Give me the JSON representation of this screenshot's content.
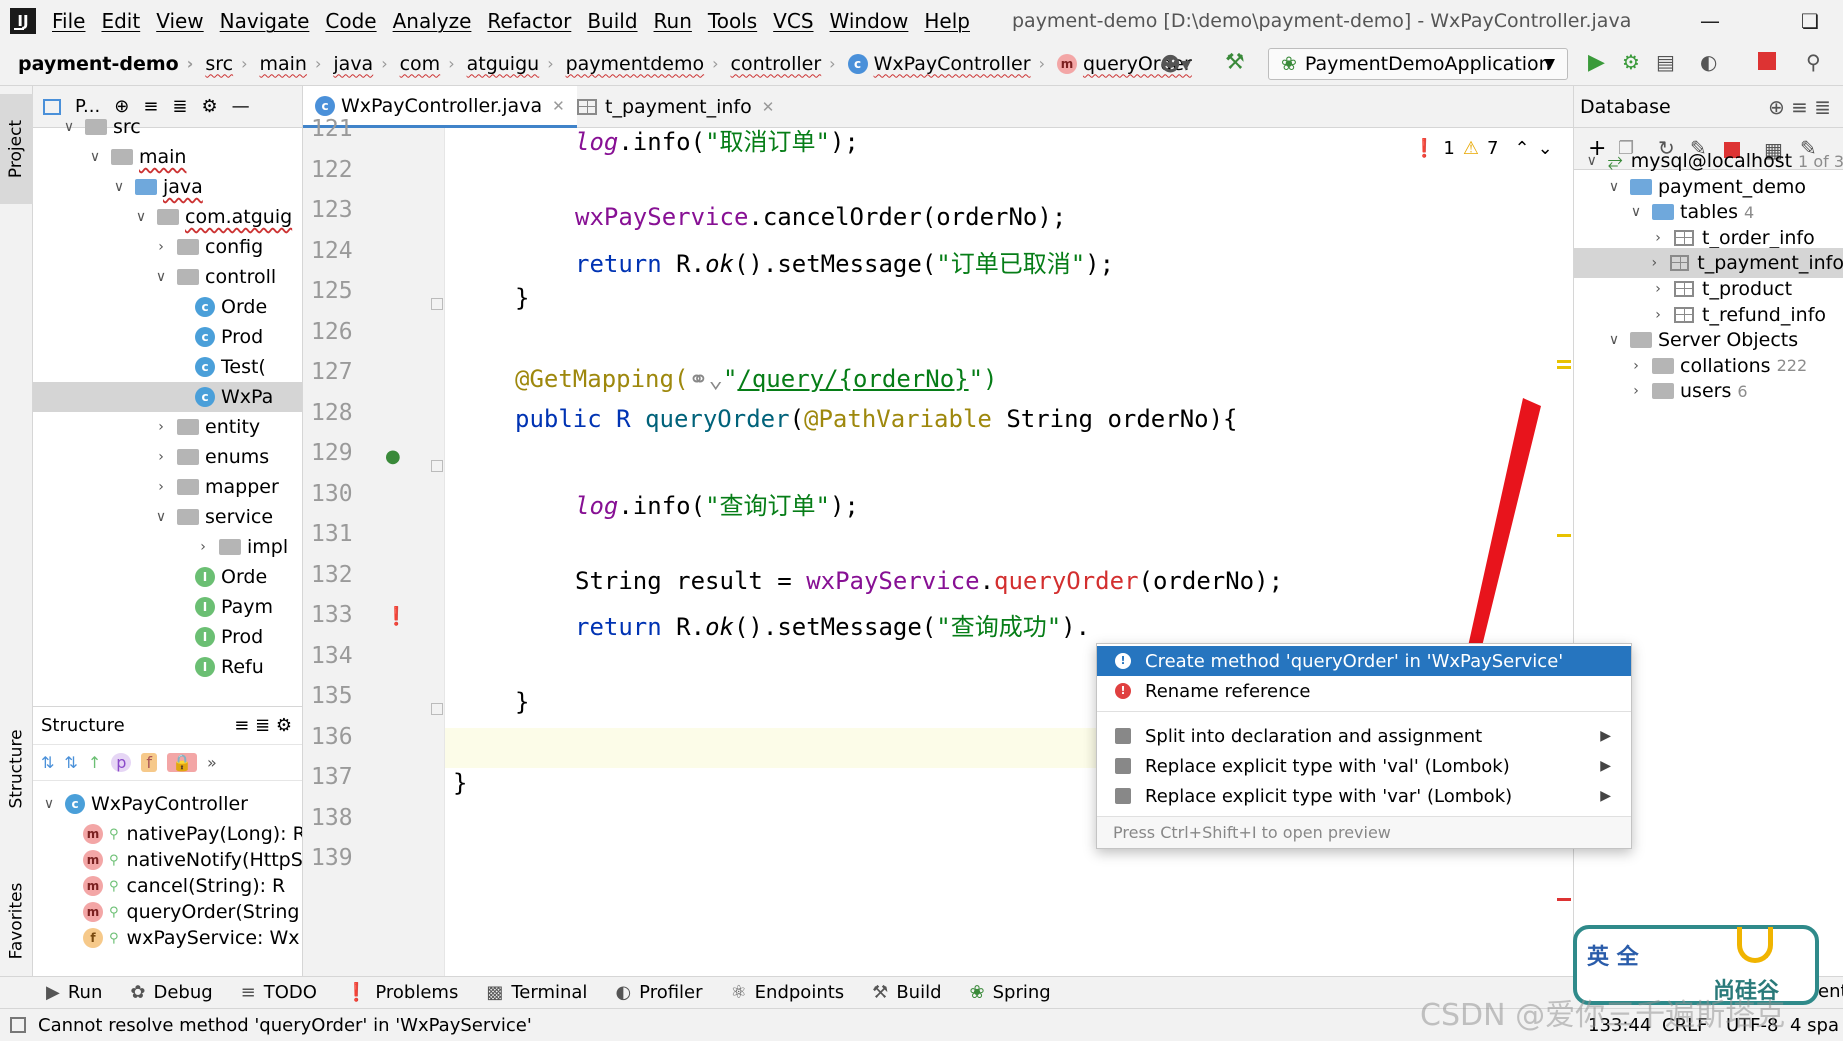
{
  "window": {
    "title": "payment-demo [D:\\demo\\payment-demo] - WxPayController.java",
    "menu": [
      "File",
      "Edit",
      "View",
      "Navigate",
      "Code",
      "Analyze",
      "Refactor",
      "Build",
      "Run",
      "Tools",
      "VCS",
      "Window",
      "Help"
    ]
  },
  "breadcrumb": {
    "items": [
      "payment-demo",
      "src",
      "main",
      "java",
      "com",
      "atguigu",
      "paymentdemo",
      "controller",
      "WxPayController",
      "queryOrder"
    ]
  },
  "run_config": {
    "label": "PaymentDemoApplication"
  },
  "left_stripe": {
    "project": "Project",
    "structure": "Structure",
    "favorites": "Favorites"
  },
  "project_panel": {
    "header": "P...",
    "tree": [
      {
        "label": "src",
        "level": 1,
        "type": "folder"
      },
      {
        "label": "main",
        "level": 2,
        "type": "folder"
      },
      {
        "label": "java",
        "level": 3,
        "type": "folder-blue"
      },
      {
        "label": "com.atguig",
        "level": 4,
        "type": "package"
      },
      {
        "label": "config",
        "level": 5,
        "type": "package"
      },
      {
        "label": "controll",
        "level": 5,
        "type": "package"
      },
      {
        "label": "Orde",
        "level": 6,
        "type": "class"
      },
      {
        "label": "Prod",
        "level": 6,
        "type": "class"
      },
      {
        "label": "Test(",
        "level": 6,
        "type": "class"
      },
      {
        "label": "WxPa",
        "level": 6,
        "type": "class",
        "selected": true
      },
      {
        "label": "entity",
        "level": 5,
        "type": "package"
      },
      {
        "label": "enums",
        "level": 5,
        "type": "package"
      },
      {
        "label": "mapper",
        "level": 5,
        "type": "package"
      },
      {
        "label": "service",
        "level": 5,
        "type": "package"
      },
      {
        "label": "impl",
        "level": 6,
        "type": "package"
      },
      {
        "label": "Orde",
        "level": 6,
        "type": "interface"
      },
      {
        "label": "Paym",
        "level": 6,
        "type": "interface"
      },
      {
        "label": "Prod",
        "level": 6,
        "type": "interface"
      },
      {
        "label": "Refu",
        "level": 6,
        "type": "interface"
      }
    ]
  },
  "structure_panel": {
    "title": "Structure",
    "root": "WxPayController",
    "members": [
      {
        "badge": "m",
        "label": "nativePay(Long): R"
      },
      {
        "badge": "m",
        "label": "nativeNotify(HttpS"
      },
      {
        "badge": "m",
        "label": "cancel(String): R"
      },
      {
        "badge": "m",
        "label": "queryOrder(String"
      },
      {
        "badge": "f",
        "label": "wxPayService: Wx"
      }
    ]
  },
  "editor_tabs": [
    {
      "label": "WxPayController.java",
      "active": true
    },
    {
      "label": "t_payment_info",
      "active": false
    }
  ],
  "inspections": {
    "errors": "1",
    "warnings": "7"
  },
  "line_numbers": [
    "121",
    "122",
    "123",
    "124",
    "125",
    "126",
    "127",
    "128",
    "129",
    "130",
    "131",
    "132",
    "133",
    "134",
    "135",
    "136",
    "137",
    "138",
    "139"
  ],
  "code": {
    "l121": {
      "a": "log",
      "b": ".info(",
      "c": "\"取消订单\"",
      "d": ");"
    },
    "l123": {
      "a": "wxPayService",
      "b": ".cancelOrder(orderNo);"
    },
    "l124": {
      "a": "return ",
      "b": "R.",
      "c": "ok",
      "d": "().setMessage(",
      "e": "\"订单已取消\"",
      "f": ");"
    },
    "l125": "}",
    "l128": {
      "a": "@GetMapping(",
      "b": "\"",
      "c": "/query/{orderNo}",
      "d": "\")"
    },
    "l129": {
      "a": "public ",
      "b": "R ",
      "c": "queryOrder",
      "d": "(",
      "e": "@PathVariable ",
      "f": "String orderNo){"
    },
    "l131": {
      "a": "log",
      "b": ".info(",
      "c": "\"查询订单\"",
      "d": ");"
    },
    "l133": {
      "a": "String result = ",
      "b": "wxPayService",
      "c": ".",
      "d": "queryOrder",
      "e": "(orderNo);"
    },
    "l134": {
      "a": "return ",
      "b": "R.",
      "c": "ok",
      "d": "().setMessage(",
      "e": "\"查询成功\"",
      "f": ")."
    },
    "l136": "}",
    "l138": "}"
  },
  "popup": {
    "items": [
      {
        "label": "Create method 'queryOrder' in 'WxPayService'",
        "selected": true,
        "icon": "bulb-error-icon"
      },
      {
        "label": "Rename reference",
        "icon": "bulb-error-icon"
      },
      {
        "label": "Split into declaration and assignment",
        "icon": "intention-icon",
        "submenu": true
      },
      {
        "label": "Replace explicit type with 'val' (Lombok)",
        "icon": "intention-icon",
        "submenu": true
      },
      {
        "label": "Replace explicit type with 'var' (Lombok)",
        "icon": "intention-icon",
        "submenu": true
      }
    ],
    "footer": "Press Ctrl+Shift+I to open preview"
  },
  "database_panel": {
    "title": "Database",
    "tree": [
      {
        "label": "mysql@localhost",
        "suffix": "1 of 3"
      },
      {
        "label": "payment_demo"
      },
      {
        "label": "tables",
        "suffix": "4"
      },
      {
        "label": "t_order_info"
      },
      {
        "label": "t_payment_info",
        "selected": true
      },
      {
        "label": "t_product"
      },
      {
        "label": "t_refund_info"
      },
      {
        "label": "Server Objects"
      },
      {
        "label": "collations",
        "suffix": "222"
      },
      {
        "label": "users",
        "suffix": "6"
      }
    ]
  },
  "bottom_tools": [
    "Run",
    "Debug",
    "TODO",
    "Problems",
    "Terminal",
    "Profiler",
    "Endpoints",
    "Build",
    "Spring"
  ],
  "status": {
    "message": "Cannot resolve method 'queryOrder' in 'WxPayService'",
    "position": "133:44",
    "line_sep": "CRLF",
    "encoding": "UTF-8",
    "indent": "4 spa",
    "event_log": "ent"
  },
  "overlay": {
    "ime": "英 全",
    "brand": "尚硅谷",
    "watermark": "CSDN @爱你三千遍斯塔克"
  },
  "colors": {
    "accent": "#2675bf",
    "error": "#e04040",
    "arrow": "#e8141c"
  }
}
